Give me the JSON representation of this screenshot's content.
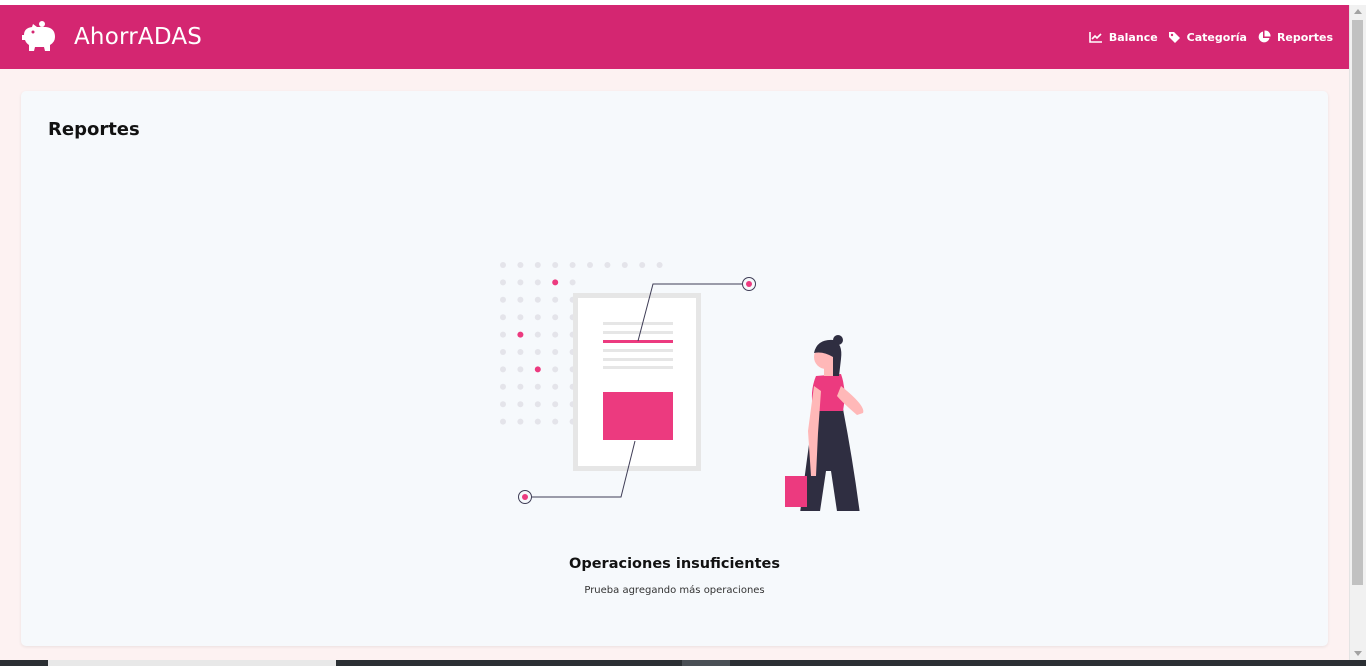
{
  "navbar": {
    "brand_title": "AhorrADAS",
    "brand_icon": "piggy-bank-icon",
    "links": [
      {
        "label": "Balance",
        "icon": "chart-line-icon"
      },
      {
        "label": "Categoría",
        "icon": "tag-icon"
      },
      {
        "label": "Reportes",
        "icon": "chart-pie-icon"
      }
    ]
  },
  "main": {
    "title": "Reportes",
    "empty_state": {
      "title": "Operaciones insuficientes",
      "subtitle": "Prueba agregando más operaciones"
    }
  },
  "colors": {
    "brand": "#d42671",
    "accent": "#ec3a7f",
    "card_background": "#f6f9fc",
    "page_background": "#fdf2f2"
  }
}
